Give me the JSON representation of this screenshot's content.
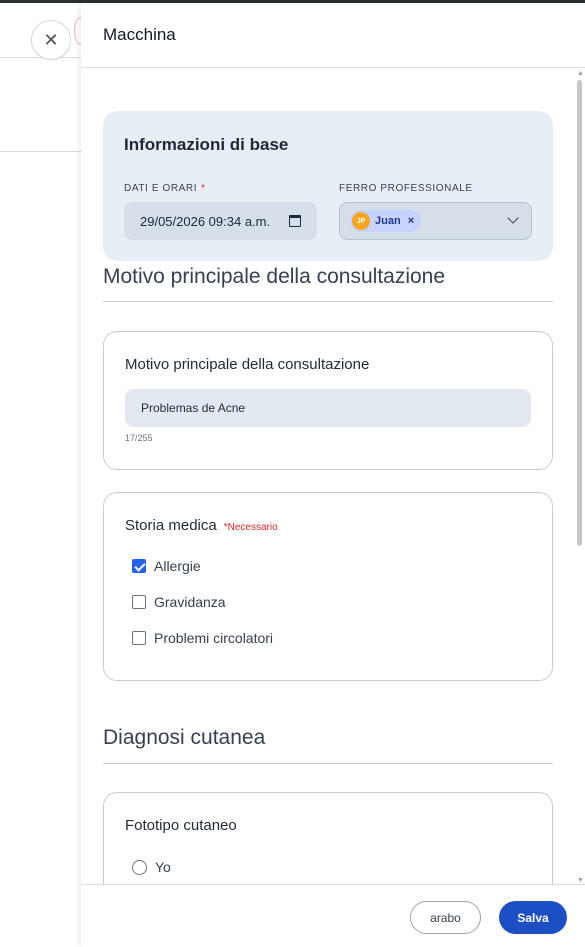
{
  "drawer": {
    "title": "Macchina",
    "close_icon": "close-icon"
  },
  "basic_info": {
    "title": "Informazioni di base",
    "date_label": "DATI E ORARI",
    "date_required_mark": "*",
    "date_value": "29/05/2026 09:34 a.m.",
    "professional_label": "FERRO PROFESSIONALE",
    "professional_chip": {
      "initials": "JP",
      "name": "Juan",
      "remove": "×"
    }
  },
  "reason_section": {
    "heading": "Motivo principale della consultazione",
    "card_title": "Motivo principale della consultazione",
    "input_value": "Problemas de Acne",
    "counter": "17/255"
  },
  "medical_history": {
    "title": "Storia medica",
    "required_tag": "*Necessario",
    "options": [
      {
        "label": "Allergie",
        "checked": true
      },
      {
        "label": "Gravidanza",
        "checked": false
      },
      {
        "label": "Problemi circolatori",
        "checked": false
      }
    ]
  },
  "skin_section": {
    "heading": "Diagnosi cutanea",
    "card_title": "Fototipo cutaneo",
    "options": [
      {
        "label": "Yo",
        "selected": false
      }
    ]
  },
  "footer": {
    "secondary_label": "arabo",
    "primary_label": "Salva"
  },
  "colors": {
    "primary": "#1d4fc4",
    "card_bg": "#e8eef6",
    "required": "#dc2626",
    "chip_avatar": "#f5a623"
  }
}
